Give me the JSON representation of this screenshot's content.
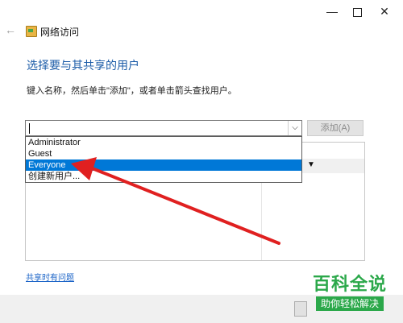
{
  "window": {
    "title": "网络访问",
    "minimize_glyph": "—",
    "close_glyph": "✕",
    "back_glyph": "←"
  },
  "main": {
    "heading": "选择要与其共享的用户",
    "instruction": "键入名称，然后单击\"添加\"，或者单击箭头查找用户。",
    "name_input_value": "",
    "add_button_label": "添加(A)",
    "help_link": "共享时有问题"
  },
  "dropdown": {
    "items": [
      {
        "label": "Administrator"
      },
      {
        "label": "Guest"
      },
      {
        "label": "Everyone",
        "selected": true
      },
      {
        "label": "创建新用户..."
      }
    ]
  },
  "icons": {
    "dropdown_arrow": "chevron-down-icon",
    "permission_arrow": "triangle-down-icon"
  },
  "colors": {
    "heading": "#1c5ca8",
    "selection": "#0078d7",
    "annotation_arrow": "#e02020",
    "watermark": "#2ba84a"
  },
  "watermark": {
    "title": "百科全说",
    "subtitle": "助你轻松解决"
  }
}
